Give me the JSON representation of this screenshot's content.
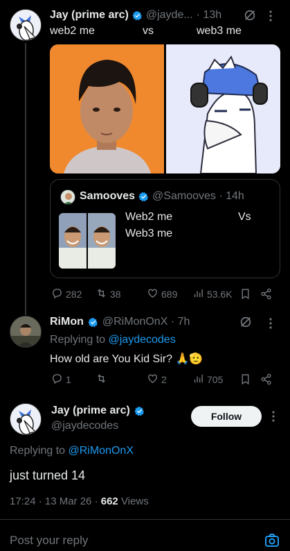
{
  "tweet1": {
    "author_name": "Jay (prime arc)",
    "handle": "@jayde...",
    "time": "· 13h",
    "text_left": "web2 me",
    "text_mid": "vs",
    "text_right": "web3 me",
    "quote": {
      "author_name": "Samooves",
      "handle": "@Samooves · 14h",
      "line1": "Web2 me",
      "line2": "Web3 me",
      "vs": "Vs"
    },
    "stats": {
      "replies": "282",
      "retweets": "38",
      "likes": "689",
      "views": "53.6K"
    }
  },
  "tweet2": {
    "author_name": "RiMon",
    "handle": "@RiMonOnX · 7h",
    "replying_prefix": "Replying to",
    "replying_to": "@jaydecodes",
    "text": "How old are You Kid Sir? 🙏🫡",
    "stats": {
      "replies": "1",
      "retweets": "",
      "likes": "2",
      "views": "705"
    }
  },
  "main": {
    "author_name": "Jay (prime arc)",
    "handle": "@jaydecodes",
    "follow_label": "Follow",
    "replying_prefix": "Replying to",
    "replying_to": "@RiMonOnX",
    "text": "just turned 14",
    "timestamp": "17:24 · 13 Mar 26 ·",
    "views_count": "662",
    "views_label": "Views"
  },
  "reply_bar": {
    "placeholder": "Post your reply"
  },
  "colors": {
    "accent": "#1d9bf0",
    "background": "#000000",
    "muted": "#71767b"
  },
  "icons": [
    "verified-badge-icon",
    "grok-icon",
    "more-icon",
    "reply-icon",
    "retweet-icon",
    "like-icon",
    "views-icon",
    "bookmark-icon",
    "share-icon",
    "camera-icon"
  ]
}
